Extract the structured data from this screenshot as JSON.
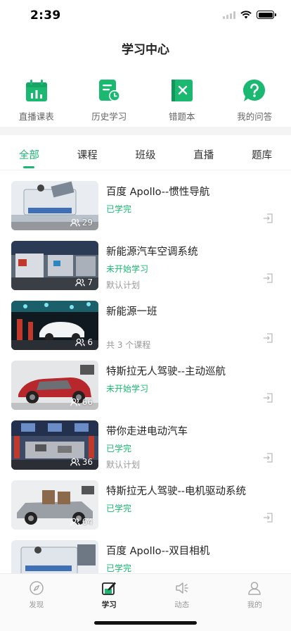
{
  "status_bar": {
    "time": "2:39"
  },
  "nav": {
    "title": "学习中心"
  },
  "quick_entries": [
    {
      "label": "直播课表",
      "icon": "calendar-chart-icon"
    },
    {
      "label": "历史学习",
      "icon": "history-doc-icon"
    },
    {
      "label": "错题本",
      "icon": "wrong-book-icon"
    },
    {
      "label": "我的问答",
      "icon": "question-bubble-icon"
    }
  ],
  "tabs": [
    {
      "label": "全部",
      "active": true
    },
    {
      "label": "课程",
      "active": false
    },
    {
      "label": "班级",
      "active": false
    },
    {
      "label": "直播",
      "active": false
    },
    {
      "label": "题库",
      "active": false
    }
  ],
  "courses": [
    {
      "title": "百度 Apollo--惯性导航",
      "status": "已学完",
      "sub": "",
      "learners": "29"
    },
    {
      "title": "新能源汽车空调系统",
      "status": "未开始学习",
      "sub": "默认计划",
      "learners": "7"
    },
    {
      "title": "新能源一班",
      "status": "",
      "sub": "共 3 个课程",
      "learners": "6"
    },
    {
      "title": "特斯拉无人驾驶--主动巡航",
      "status": "未开始学习",
      "sub": "",
      "learners": "66"
    },
    {
      "title": "带你走进电动汽车",
      "status": "已学完",
      "sub": "默认计划",
      "learners": "36"
    },
    {
      "title": "特斯拉无人驾驶--电机驱动系统",
      "status": "已学完",
      "sub": "",
      "learners": "64"
    },
    {
      "title": "百度 Apollo--双目相机",
      "status": "已学完",
      "sub": "",
      "learners": ""
    }
  ],
  "tabbar": [
    {
      "label": "发现",
      "icon": "compass-icon",
      "active": false
    },
    {
      "label": "学习",
      "icon": "study-edit-icon",
      "active": true
    },
    {
      "label": "动态",
      "icon": "speaker-icon",
      "active": false
    },
    {
      "label": "我的",
      "icon": "person-icon",
      "active": false
    }
  ],
  "colors": {
    "accent": "#1bb872",
    "text": "#222222",
    "muted": "#999999"
  }
}
